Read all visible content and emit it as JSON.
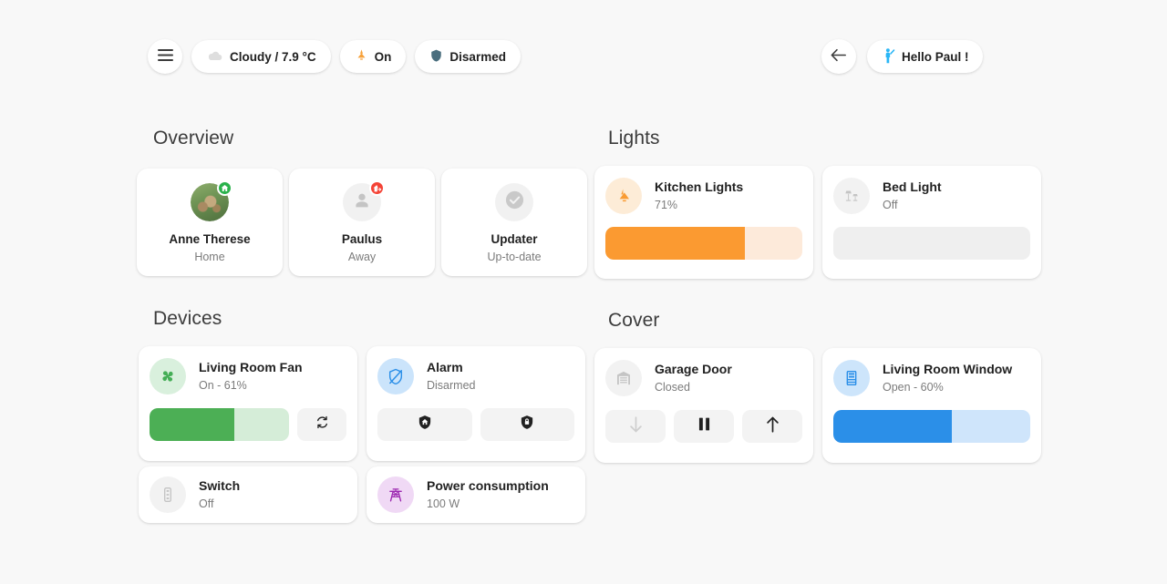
{
  "header": {
    "menu_icon": "hamburger-menu-icon",
    "weather": {
      "icon": "cloud-icon",
      "label": "Cloudy / 7.9 °C"
    },
    "light_chip": {
      "icon": "ceiling-light-icon",
      "label": "On"
    },
    "alarm_chip": {
      "icon": "shield-icon",
      "label": "Disarmed"
    },
    "back_icon": "back-arrow-icon",
    "greeting": {
      "icon": "human-greeting-icon",
      "label": "Hello Paul !"
    }
  },
  "sections": {
    "overview": {
      "title": "Overview"
    },
    "lights": {
      "title": "Lights"
    },
    "devices": {
      "title": "Devices"
    },
    "cover": {
      "title": "Cover"
    }
  },
  "people": [
    {
      "name": "Anne Therese",
      "state": "Home",
      "badge": "home-badge",
      "badge_color": "#2ab24b",
      "avatar": "photo-avatar"
    },
    {
      "name": "Paulus",
      "state": "Away",
      "badge": "home-export-badge",
      "badge_color": "#f44336",
      "avatar": "person-icon"
    },
    {
      "name": "Updater",
      "state": "Up-to-date",
      "badge": "none",
      "badge_color": "",
      "avatar": "check-circle-icon"
    }
  ],
  "lights": [
    {
      "name": "Kitchen Lights",
      "state": "71%",
      "icon": "ceiling-light-icon",
      "icon_color": "#f99b33",
      "icon_bg": "#fdecd7",
      "slider": {
        "value": 71,
        "fill": "#fb9a31",
        "track": "#fdeada"
      }
    },
    {
      "name": "Bed Light",
      "state": "Off",
      "icon": "lamps-icon",
      "icon_color": "#c4c4c4",
      "icon_bg": "#f2f2f2",
      "slider": {
        "value": 0,
        "fill": "#efefef",
        "track": "#efefef"
      }
    }
  ],
  "devices": [
    {
      "name": "Living Room Fan",
      "state": "On - 61%",
      "icon": "fan-icon",
      "icon_color": "#44ae56",
      "icon_bg": "#d9f0dd",
      "slider": {
        "value": 61,
        "fill": "#4caf55",
        "track": "#d5edd8"
      },
      "button": {
        "icon": "rotate-refresh-icon",
        "label": ""
      }
    },
    {
      "name": "Alarm",
      "state": "Disarmed",
      "icon": "shield-off-icon",
      "icon_color": "#2b8fe8",
      "icon_bg": "#cbe4fb",
      "buttons": [
        {
          "icon": "shield-home-icon"
        },
        {
          "icon": "shield-lock-icon"
        }
      ]
    },
    {
      "name": "Switch",
      "state": "Off",
      "icon": "toggle-switch-icon",
      "icon_color": "#c4c4c4",
      "icon_bg": "#f2f2f2"
    },
    {
      "name": "Power consumption",
      "state": "100 W",
      "icon": "transmission-tower-icon",
      "icon_color": "#9c27b0",
      "icon_bg": "#f0d9f5"
    }
  ],
  "covers": [
    {
      "name": "Garage Door",
      "state": "Closed",
      "icon": "garage-icon",
      "icon_color": "#c4c4c4",
      "icon_bg": "#f2f2f2",
      "buttons": [
        {
          "icon": "arrow-down-icon",
          "disabled": true
        },
        {
          "icon": "pause-icon",
          "disabled": false
        },
        {
          "icon": "arrow-up-icon",
          "disabled": false
        }
      ]
    },
    {
      "name": "Living Room Window",
      "state": "Open - 60%",
      "icon": "window-shutter-icon",
      "icon_color": "#2b8fe8",
      "icon_bg": "#cde5fb",
      "slider": {
        "value": 60,
        "fill": "#2b8fe8",
        "track": "#cfe5fb"
      }
    }
  ]
}
